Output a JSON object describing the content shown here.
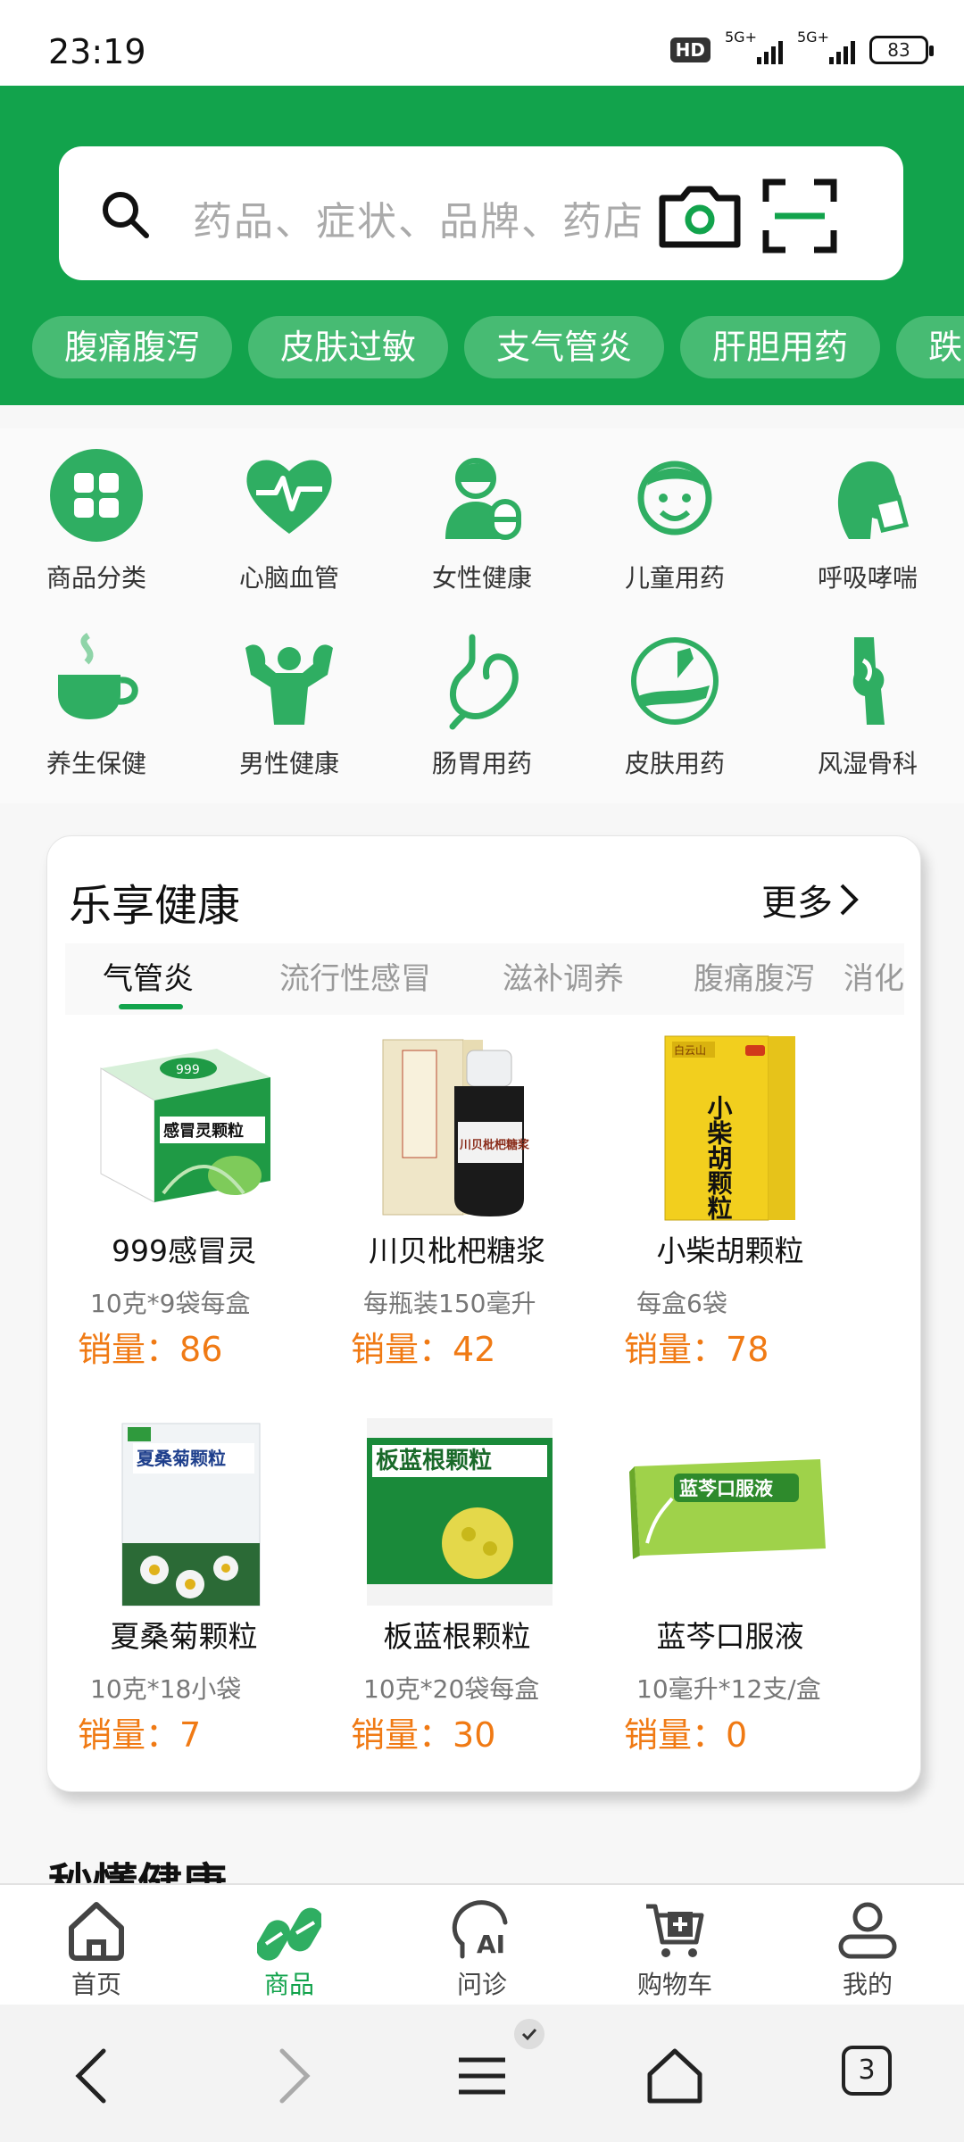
{
  "status_bar": {
    "time": "23:19",
    "hd_label": "HD",
    "network_1": "5G+",
    "network_2": "5G+",
    "battery": "83"
  },
  "search": {
    "placeholder": "药品、症状、品牌、药店",
    "icons": [
      "search-icon",
      "camera-icon",
      "scan-icon"
    ]
  },
  "symptom_chips": [
    "腹痛腹泻",
    "皮肤过敏",
    "支气管炎",
    "肝胆用药",
    "跌"
  ],
  "categories": [
    {
      "label": "商品分类",
      "icon": "grid-icon"
    },
    {
      "label": "心脑血管",
      "icon": "heart-pulse-icon"
    },
    {
      "label": "女性健康",
      "icon": "woman-icon"
    },
    {
      "label": "儿童用药",
      "icon": "child-icon"
    },
    {
      "label": "呼吸哮喘",
      "icon": "breathing-icon"
    },
    {
      "label": "养生保健",
      "icon": "tea-cup-icon"
    },
    {
      "label": "男性健康",
      "icon": "muscle-man-icon"
    },
    {
      "label": "肠胃用药",
      "icon": "stomach-icon"
    },
    {
      "label": "皮肤用药",
      "icon": "skin-icon"
    },
    {
      "label": "风湿骨科",
      "icon": "joint-icon"
    }
  ],
  "health_card": {
    "title": "乐享健康",
    "more": "更多",
    "tabs": [
      "气管炎",
      "流行性感冒",
      "滋补调养",
      "腹痛腹泻",
      "消化"
    ],
    "active_tab": "气管炎",
    "sales_prefix": "销量：",
    "products": [
      {
        "name": "999感冒灵",
        "spec": "10克*9袋每盒",
        "sales": "86",
        "box_text": "感冒灵颗粒",
        "brand": "999"
      },
      {
        "name": "川贝枇杷糖浆",
        "spec": "每瓶装150毫升",
        "sales": "42",
        "box_text": "川贝枇杷糖浆",
        "brand": ""
      },
      {
        "name": "小柴胡颗粒",
        "spec": "每盒6袋",
        "sales": "78",
        "box_text": "小柴胡颗粒",
        "brand": "白云山"
      },
      {
        "name": "夏桑菊颗粒",
        "spec": "10克*18小袋",
        "sales": "7",
        "box_text": "夏桑菊颗粒",
        "brand": ""
      },
      {
        "name": "板蓝根颗粒",
        "spec": "10克*20袋每盒",
        "sales": "30",
        "box_text": "板蓝根颗粒",
        "brand": ""
      },
      {
        "name": "蓝芩口服液",
        "spec": "10毫升*12支/盒",
        "sales": "0",
        "box_text": "蓝芩口服液",
        "brand": ""
      }
    ]
  },
  "next_section_title": "秒懂健康",
  "bottom_nav": [
    {
      "label": "首页",
      "icon": "home-icon",
      "active": false
    },
    {
      "label": "商品",
      "icon": "pills-icon",
      "active": true
    },
    {
      "label": "问诊",
      "icon": "ai-consult-icon",
      "active": false
    },
    {
      "label": "购物车",
      "icon": "cart-icon",
      "active": false
    },
    {
      "label": "我的",
      "icon": "user-icon",
      "active": false
    }
  ],
  "system_bar": {
    "tab_count": "3"
  },
  "colors": {
    "brand_green": "#12a34c",
    "chip_green": "#47bb73",
    "sales_orange": "#f07a14"
  }
}
